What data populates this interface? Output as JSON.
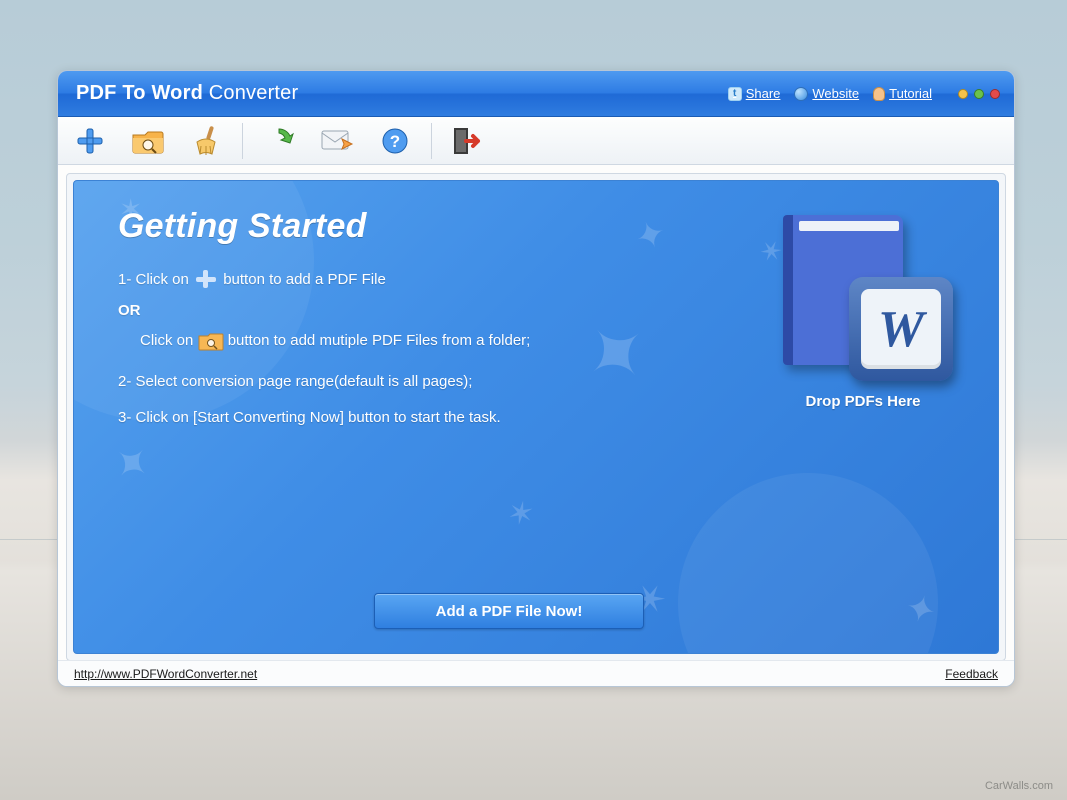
{
  "titlebar": {
    "title_bold": "PDF To Word",
    "title_thin": " Converter",
    "links": {
      "share": "Share",
      "website": "Website",
      "tutorial": "Tutorial"
    }
  },
  "toolbar": {
    "icons": {
      "add": "add-file-icon",
      "folder": "add-folder-icon",
      "clear": "clear-icon",
      "convert": "convert-icon",
      "email": "email-icon",
      "help": "help-icon",
      "exit": "exit-icon"
    }
  },
  "main": {
    "heading": "Getting Started",
    "step1a": "1- Click on ",
    "step1b": " button to add a PDF File",
    "or": "OR",
    "step1c_a": "Click on ",
    "step1c_b": " button to add mutiple PDF Files from a folder;",
    "step2": "2- Select conversion page range(default is all pages);",
    "step3": "3- Click on [Start Converting Now] button to start the task.",
    "cta": "Add a PDF File Now!",
    "dropzone": {
      "caption": "Drop PDFs Here",
      "tile_letter": "W"
    }
  },
  "footer": {
    "url": "http://www.PDFWordConverter.net",
    "feedback": "Feedback"
  },
  "background": {
    "watermark": "CarWalls.com"
  }
}
